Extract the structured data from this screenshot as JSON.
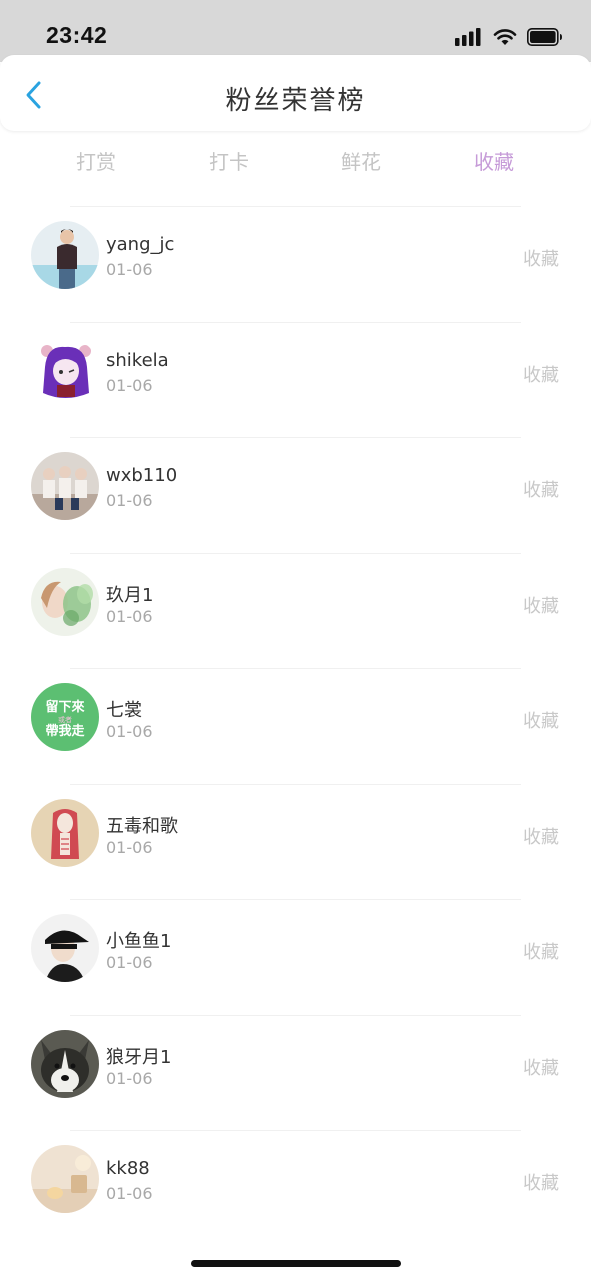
{
  "status_bar": {
    "time": "23:42"
  },
  "nav": {
    "title": "粉丝荣誉榜"
  },
  "tabs": [
    {
      "label": "打赏",
      "active": false
    },
    {
      "label": "打卡",
      "active": false
    },
    {
      "label": "鲜花",
      "active": false
    },
    {
      "label": "收藏",
      "active": true
    }
  ],
  "colors": {
    "accent": "#c69bd8",
    "back_arrow": "#2aa3e0",
    "avatar_green": "#5cbf72"
  },
  "fans": [
    {
      "name": "yang_jc",
      "date": "01-06",
      "action": "收藏",
      "avatar": "person-photo"
    },
    {
      "name": "shikela",
      "date": "01-06",
      "action": "收藏",
      "avatar": "anime-girl-purple"
    },
    {
      "name": "wxb110",
      "date": "01-06",
      "action": "收藏",
      "avatar": "group-photo"
    },
    {
      "name": "玖月1",
      "date": "01-06",
      "action": "收藏",
      "avatar": "girl-with-leaves"
    },
    {
      "name": "七裳",
      "date": "01-06",
      "action": "收藏",
      "avatar": "green-text-badge",
      "avatar_text": [
        "留下來",
        "或者",
        "帶我走"
      ]
    },
    {
      "name": "五毒和歌",
      "date": "01-06",
      "action": "收藏",
      "avatar": "red-hair-drawing"
    },
    {
      "name": "小鱼鱼1",
      "date": "01-06",
      "action": "收藏",
      "avatar": "boy-in-cap"
    },
    {
      "name": "狼牙月1",
      "date": "01-06",
      "action": "收藏",
      "avatar": "husky-dog"
    },
    {
      "name": "kk88",
      "date": "01-06",
      "action": "收藏",
      "avatar": "warm-still-life"
    }
  ]
}
